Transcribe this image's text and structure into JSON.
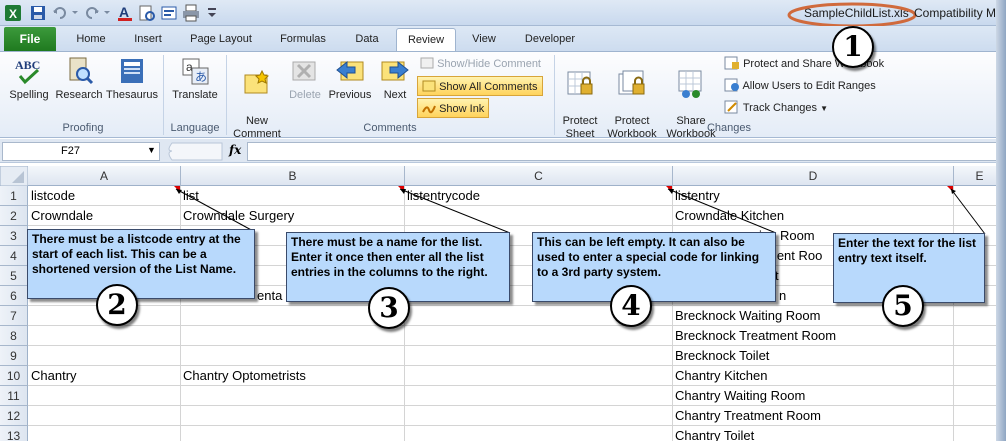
{
  "window": {
    "filename": "SampleChildList.xls",
    "mode_suffix": "Compatibility M"
  },
  "tabs": [
    {
      "label": "File"
    },
    {
      "label": "Home"
    },
    {
      "label": "Insert"
    },
    {
      "label": "Page Layout"
    },
    {
      "label": "Formulas"
    },
    {
      "label": "Data"
    },
    {
      "label": "Review"
    },
    {
      "label": "View"
    },
    {
      "label": "Developer"
    }
  ],
  "ribbon": {
    "proofing": {
      "label": "Proofing",
      "spelling": "Spelling",
      "research": "Research",
      "thesaurus": "Thesaurus"
    },
    "language": {
      "label": "Language",
      "translate": "Translate"
    },
    "comments": {
      "label": "Comments",
      "new_comment": "New\nComment",
      "delete": "Delete",
      "previous": "Previous",
      "next": "Next",
      "show_hide": "Show/Hide Comment",
      "show_all": "Show All Comments",
      "show_ink": "Show Ink"
    },
    "changes": {
      "label": "Changes",
      "protect_sheet": "Protect\nSheet",
      "protect_workbook": "Protect\nWorkbook",
      "share_workbook": "Share\nWorkbook",
      "protect_share": "Protect and Share Workbook",
      "allow_users": "Allow Users to Edit Ranges",
      "track_changes": "Track Changes"
    }
  },
  "formula_bar": {
    "name_box": "F27",
    "fx": "fx"
  },
  "columns": [
    "A",
    "B",
    "C",
    "D",
    "E"
  ],
  "rows": [
    "1",
    "2",
    "3",
    "4",
    "5",
    "6",
    "7",
    "8",
    "9",
    "10",
    "11",
    "12",
    "13"
  ],
  "cells": {
    "a1": "listcode",
    "b1": "list",
    "c1": "listentrycode",
    "d1": "listentry",
    "a2": "Crowndale",
    "b2": "Crowndale Surgery",
    "d2": "Crowndale Kitchen",
    "d3_partial": "ing Room",
    "d4_partial": "ment Roo",
    "b6_partial": "enta",
    "d5_partial": "t",
    "d6_partial": "n",
    "d7": "Brecknock Waiting Room",
    "d8": "Brecknock Treatment Room",
    "d9": "Brecknock Toilet",
    "a10": "Chantry",
    "b10": "Chantry Optometrists",
    "d10": "Chantry Kitchen",
    "d11": "Chantry Waiting Room",
    "d12": "Chantry Treatment Room",
    "d13": "Chantry Toilet"
  },
  "comments": {
    "c2": "There must be a listcode entry at the start of each list. This can be a shortened version of the List Name.",
    "c3": "There must be a name for the list. Enter it once then enter all the list entries in the columns to the right.",
    "c4": "This can be left empty.  It can also be used to enter a special code for linking to a 3rd party system.",
    "c5": "Enter the text for the list entry text itself."
  },
  "badges": {
    "b1": "1",
    "b2": "2",
    "b3": "3",
    "b4": "4",
    "b5": "5"
  }
}
